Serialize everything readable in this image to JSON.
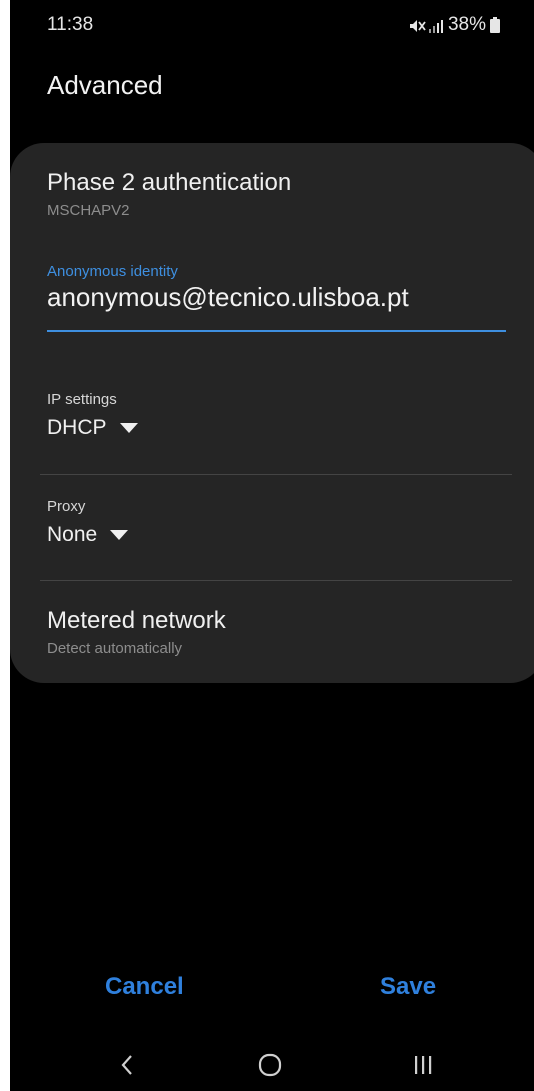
{
  "status_bar": {
    "time": "11:38",
    "battery": "38%",
    "icons": [
      "mute-icon",
      "signal-icon",
      "battery-icon"
    ]
  },
  "page": {
    "title": "Advanced"
  },
  "settings": {
    "phase2": {
      "title": "Phase 2 authentication",
      "value": "MSCHAPV2"
    },
    "anonymous_identity": {
      "label": "Anonymous identity",
      "value": "anonymous@tecnico.ulisboa.pt"
    },
    "ip_settings": {
      "label": "IP settings",
      "selected": "DHCP"
    },
    "proxy": {
      "label": "Proxy",
      "selected": "None"
    },
    "metered": {
      "title": "Metered network",
      "value": "Detect automatically"
    }
  },
  "actions": {
    "cancel": "Cancel",
    "save": "Save"
  },
  "nav": {
    "icons": [
      "back-icon",
      "home-icon",
      "recents-icon"
    ]
  },
  "colors": {
    "background": "#000000",
    "card": "#252525",
    "accent": "#3e8fe0",
    "button_text": "#2f80dd"
  }
}
